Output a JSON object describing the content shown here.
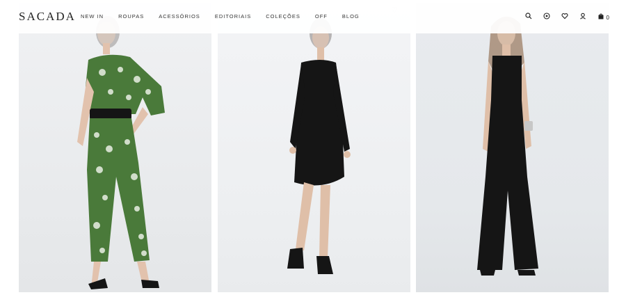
{
  "brand": {
    "logo_text": "SACADA"
  },
  "nav": {
    "items": [
      {
        "label": "NEW IN"
      },
      {
        "label": "ROUPAS"
      },
      {
        "label": "ACESSÓRIOS"
      },
      {
        "label": "EDITORIAIS"
      },
      {
        "label": "COLEÇÕES"
      },
      {
        "label": "OFF"
      },
      {
        "label": "BLOG"
      }
    ]
  },
  "header_icons": {
    "search": "search-icon",
    "location": "location-pin-icon",
    "wishlist": "heart-icon",
    "account": "user-icon",
    "cart": "shopping-bag-icon",
    "cart_count": "0"
  },
  "products": [
    {
      "image": "woman-green-print-jumpsuit-black-belt-sandals",
      "wishlist_icon": "heart-outline-icon"
    },
    {
      "image": "woman-black-long-sleeve-dress-black-sandals",
      "wishlist_icon": "heart-outline-icon"
    },
    {
      "image": "woman-black-sleeveless-wide-leg-jumpsuit",
      "wishlist_icon": "heart-outline-icon"
    }
  ],
  "colors": {
    "text": "#222222",
    "header_bg": "#ffffff",
    "card_bg": "#eef0f2",
    "green_print": "#4a7a3a"
  }
}
